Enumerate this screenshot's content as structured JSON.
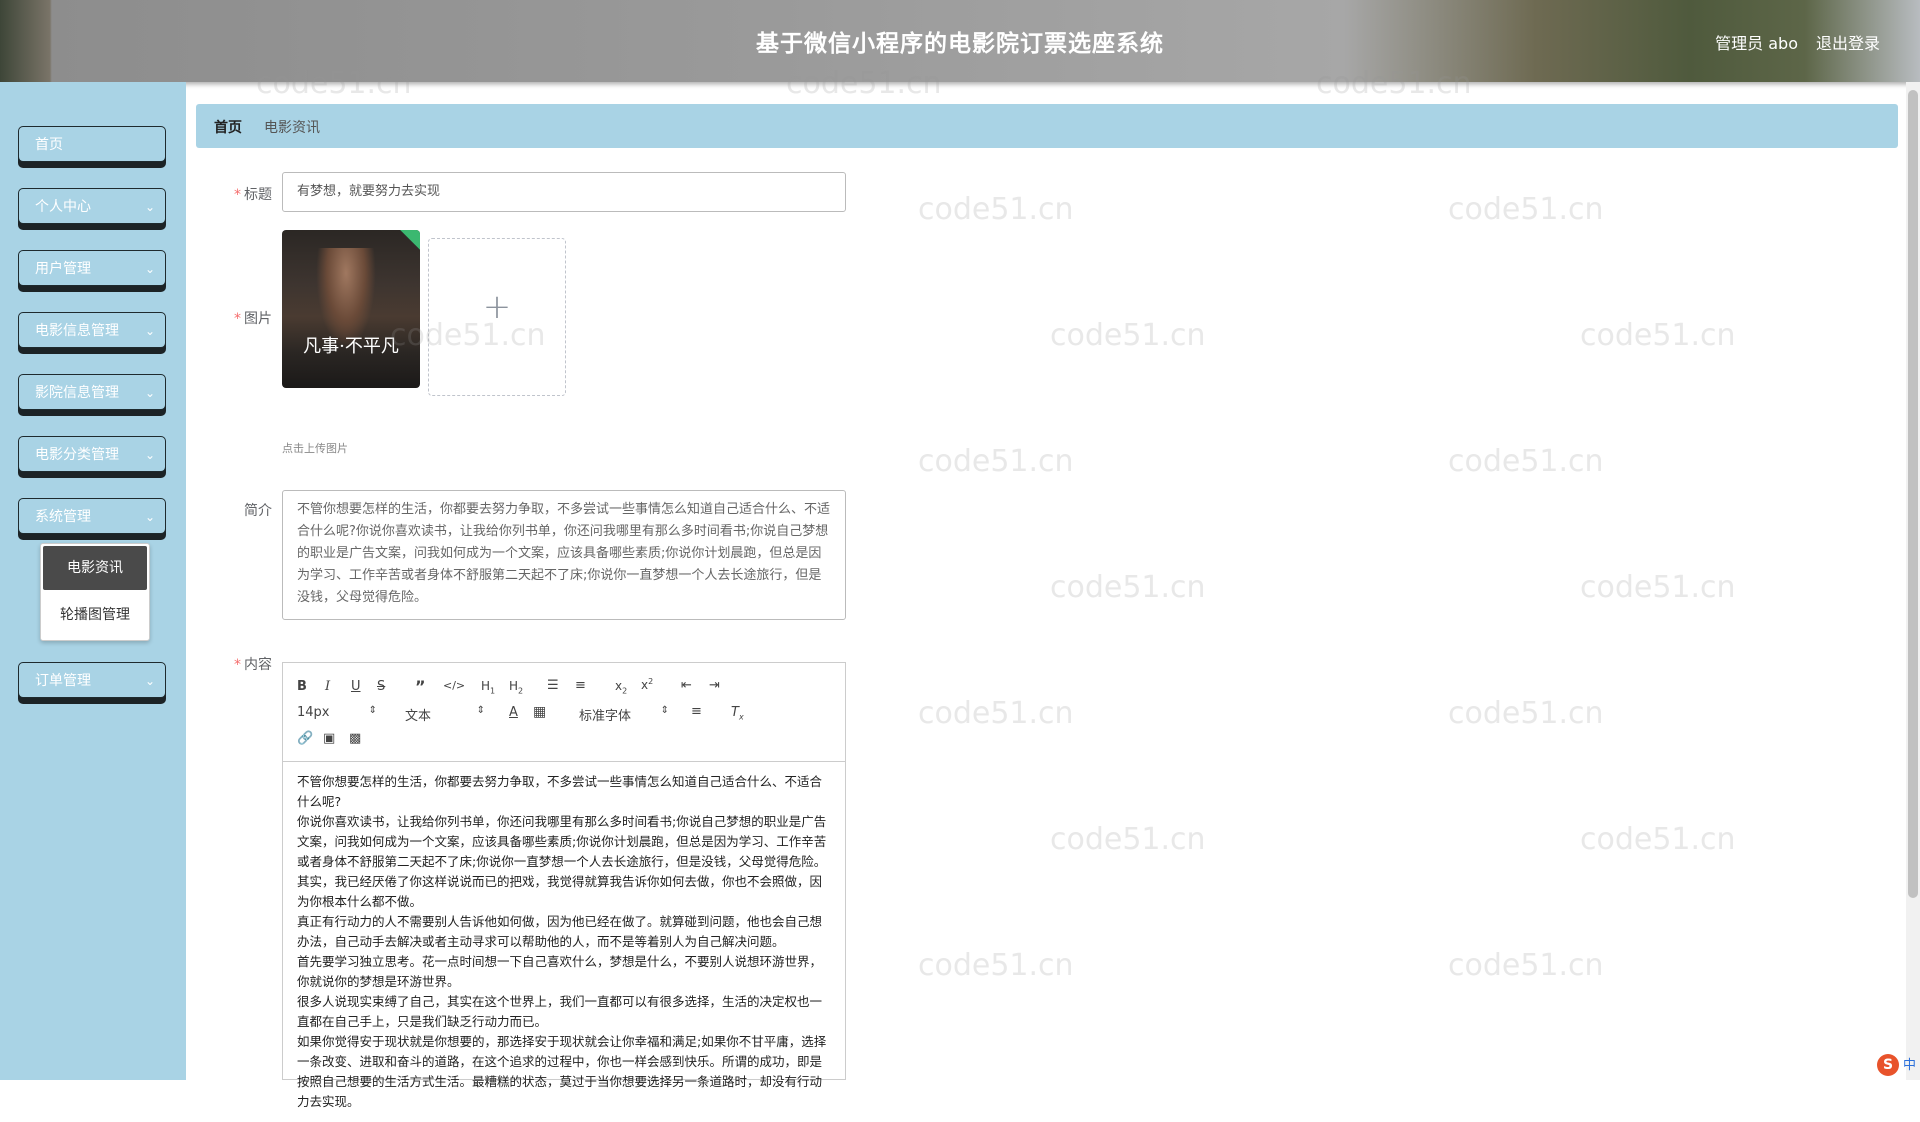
{
  "header": {
    "title": "基于微信小程序的电影院订票选座系统",
    "admin": "管理员 abo",
    "logout": "退出登录"
  },
  "sidebar": {
    "items": [
      {
        "label": "首页"
      },
      {
        "label": "个人中心"
      },
      {
        "label": "用户管理"
      },
      {
        "label": "电影信息管理"
      },
      {
        "label": "影院信息管理"
      },
      {
        "label": "电影分类管理"
      },
      {
        "label": "系统管理"
      },
      {
        "label": "订单管理"
      }
    ],
    "submenu": [
      {
        "label": "电影资讯",
        "active": true
      },
      {
        "label": "轮播图管理",
        "active": false
      }
    ]
  },
  "breadcrumb": {
    "home": "首页",
    "current": "电影资讯"
  },
  "form": {
    "title_label": "标题",
    "title_value": "有梦想，就要努力去实现",
    "image_label": "图片",
    "image_poster_text": "凡事·不平凡",
    "upload_hint": "点击上传图片",
    "intro_label": "简介",
    "intro_value": "不管你想要怎样的生活，你都要去努力争取，不多尝试一些事情怎么知道自己适合什么、不适合什么呢?你说你喜欢读书，让我给你列书单，你还问我哪里有那么多时间看书;你说自己梦想的职业是广告文案，问我如何成为一个文案，应该具备哪些素质;你说你计划晨跑，但总是因为学习、工作辛苦或者身体不舒服第二天起不了床;你说你一直梦想一个人去长途旅行，但是没钱，父母觉得危险。",
    "content_label": "内容"
  },
  "editor": {
    "font_size": "14px",
    "paragraph": "文本",
    "font_family": "标准字体",
    "paragraphs": [
      "不管你想要怎样的生活，你都要去努力争取，不多尝试一些事情怎么知道自己适合什么、不适合什么呢?",
      "你说你喜欢读书，让我给你列书单，你还问我哪里有那么多时间看书;你说自己梦想的职业是广告文案，问我如何成为一个文案，应该具备哪些素质;你说你计划晨跑，但总是因为学习、工作辛苦或者身体不舒服第二天起不了床;你说你一直梦想一个人去长途旅行，但是没钱，父母觉得危险。其实，我已经厌倦了你这样说说而已的把戏，我觉得就算我告诉你如何去做，你也不会照做，因为你根本什么都不做。",
      "真正有行动力的人不需要别人告诉他如何做，因为他已经在做了。就算碰到问题，他也会自己想办法，自己动手去解决或者主动寻求可以帮助他的人，而不是等着别人为自己解决问题。",
      "首先要学习独立思考。花一点时间想一下自己喜欢什么，梦想是什么，不要别人说想环游世界，你就说你的梦想是环游世界。",
      "很多人说现实束缚了自己，其实在这个世界上，我们一直都可以有很多选择，生活的决定权也一直都在自己手上，只是我们缺乏行动力而已。",
      "如果你觉得安于现状就是你想要的，那选择安于现状就会让你幸福和满足;如果你不甘平庸，选择一条改变、进取和奋斗的道路，在这个追求的过程中，你也一样会感到快乐。所谓的成功，即是按照自己想要的生活方式生活。最糟糕的状态，莫过于当你想要选择另一条道路时，却没有行动力去实现。"
    ]
  },
  "watermark": "code51.cn",
  "ime": {
    "zh": "中"
  }
}
